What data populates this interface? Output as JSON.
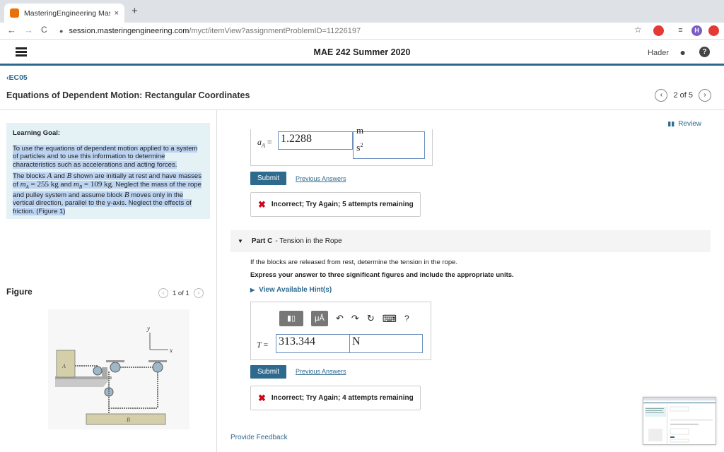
{
  "browser": {
    "tab_title": "MasteringEngineering Masterin",
    "tab_close": "×",
    "new_tab": "+",
    "url_main": "session.masteringengineering.com",
    "url_path": "/myct/itemView?assignmentProblemID=11226197",
    "back": "←",
    "forward": "→",
    "reload": "C",
    "star": "☆",
    "profile_initial": "H"
  },
  "header": {
    "course_title": "MAE 242 Summer 2020",
    "user_name": "Hader",
    "help": "?"
  },
  "breadcrumb": {
    "chevron": "‹",
    "label": "EC05"
  },
  "page": {
    "title": "Equations of Dependent Motion: Rectangular Coordinates",
    "pager_text": "2 of 5",
    "prev": "‹",
    "next": "›",
    "review_label": "Review"
  },
  "learning_goal": {
    "heading": "Learning Goal:",
    "para1": "To use the equations of dependent motion applied to a system of particles and to use this information to determine characteristics such as accelerations and acting forces.",
    "p2_a": "The blocks ",
    "p2_A": "A",
    "p2_and": " and ",
    "p2_B": "B",
    "p2_b": " shown are initially at rest and have masses of ",
    "p2_mA": "m",
    "p2_mA_sub": "A",
    "p2_mA_val": " = 255 kg",
    "p2_c": " and ",
    "p2_mB": "m",
    "p2_mB_sub": "B",
    "p2_mB_val": " = 109 kg",
    "p2_d": ". Neglect the mass of the rope and pulley system and assume block ",
    "p2_B2": "B",
    "p2_e": " moves only in the vertical direction, parallel to the y-axis. Neglect the effects of friction. (",
    "p2_fig": "Figure 1",
    "p2_f": ")"
  },
  "figure": {
    "label": "Figure",
    "pager_text": "1 of 1",
    "prev": "‹",
    "next": "›",
    "axis_y": "y",
    "axis_x": "x",
    "block_a": "A",
    "block_b": "B"
  },
  "part_b": {
    "var_label": "a",
    "var_sub": "A",
    "equals": "=",
    "value": "1.2288",
    "unit_top": "m",
    "unit_bottom": "s",
    "unit_exp": "2",
    "submit": "Submit",
    "previous_answers": "Previous Answers",
    "feedback": "Incorrect; Try Again; 5 attempts remaining",
    "x_mark": "✖"
  },
  "part_c": {
    "caret": "▼",
    "part_label": "Part C",
    "part_title": "- Tension in the Rope",
    "prompt": "If the blocks are released from rest, determine the tension in the rope.",
    "instruction": "Express your answer to three significant figures and include the appropriate units.",
    "hint_caret": "▶",
    "hint": "View Available Hint(s)",
    "toolbar": {
      "templates": "▮▯",
      "units": "μÅ",
      "undo": "↶",
      "redo": "↷",
      "reset": "↻",
      "keyboard": "⌨",
      "help": "?"
    },
    "var_label": "T",
    "equals": "=",
    "value": "313.344",
    "unit": "N",
    "submit": "Submit",
    "previous_answers": "Previous Answers",
    "feedback": "Incorrect; Try Again; 4 attempts remaining",
    "x_mark": "✖"
  },
  "footer": {
    "provide_feedback": "Provide Feedback"
  },
  "colors": {
    "accent": "#2e6a8e",
    "error": "#d0021b",
    "goal_bg": "#e4f2f6",
    "highlight": "#bcd3f1"
  }
}
